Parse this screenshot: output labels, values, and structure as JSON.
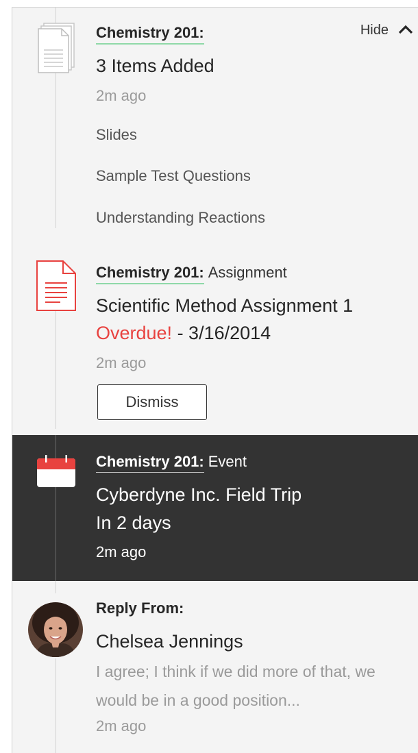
{
  "feed": {
    "hide_label": "Hide",
    "items_card": {
      "course": "Chemistry 201:",
      "title": "3 Items Added",
      "time": "2m ago",
      "items": [
        "Slides",
        "Sample Test Questions",
        "Understanding Reactions"
      ]
    },
    "assignment_card": {
      "course": "Chemistry 201:",
      "type": "Assignment",
      "title": "Scientific Method Assignment 1",
      "overdue_label": "Overdue!",
      "due_text": " - 3/16/2014",
      "time": "2m ago",
      "dismiss_label": "Dismiss"
    },
    "event_card": {
      "course": "Chemistry 201:",
      "type": "Event",
      "title": "Cyberdyne Inc. Field Trip",
      "subtitle": "In 2 days",
      "time": "2m ago"
    },
    "reply_card": {
      "label": "Reply From:",
      "name": "Chelsea Jennings",
      "message": "I agree; I think if we did more of that, we would be in a good position...",
      "time": "2m ago"
    }
  },
  "colors": {
    "accent_underline": "#8fd9a8",
    "overdue": "#e8423f",
    "event_bg": "#333333",
    "panel_bg": "#f4f4f4"
  },
  "icons": [
    "documents-icon",
    "chevron-up-icon",
    "assignment-document-icon",
    "calendar-icon",
    "avatar"
  ]
}
